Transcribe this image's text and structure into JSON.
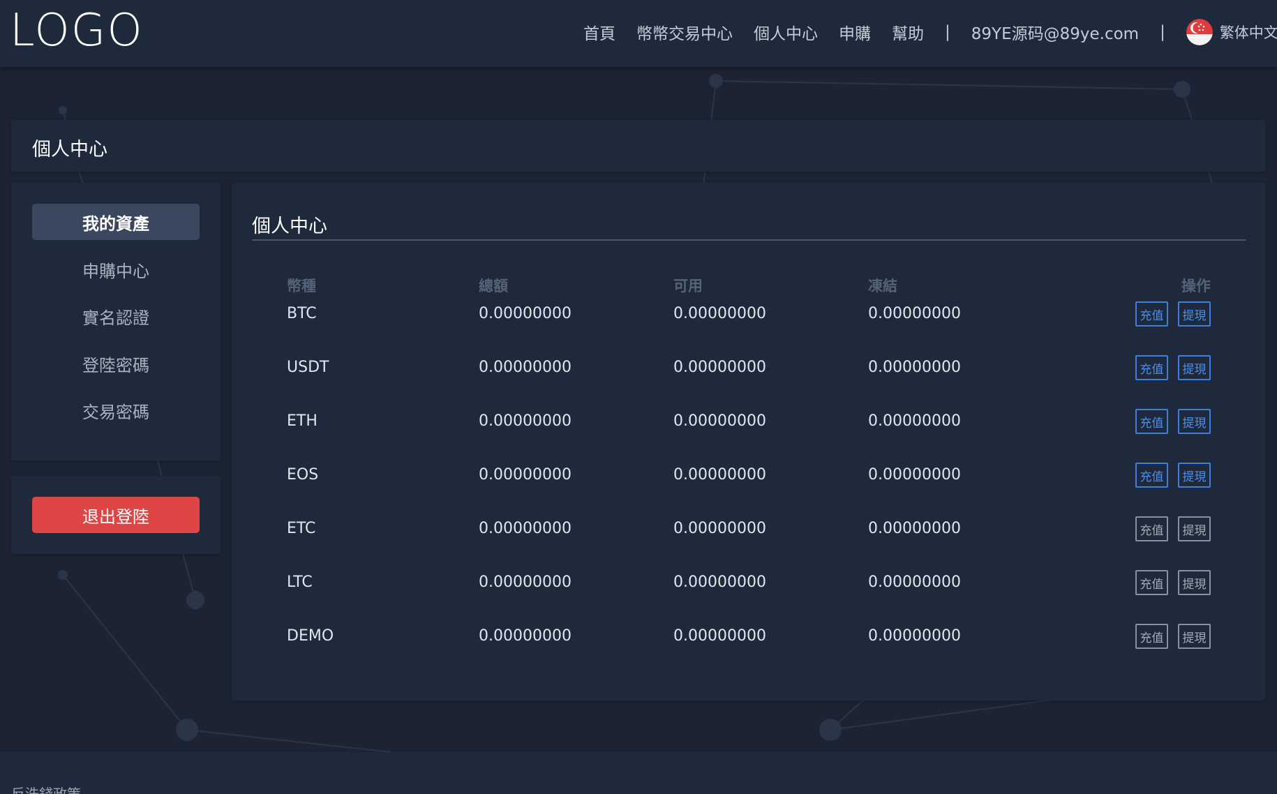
{
  "header": {
    "logo": "LOGO",
    "nav": [
      "首頁",
      "幣幣交易中心",
      "個人中心",
      "申購",
      "幫助"
    ],
    "separator": "|",
    "email": "89YE源码@89ye.com",
    "language": "繁体中文",
    "flag_icon": "singapore-flag-icon"
  },
  "page_title": "個人中心",
  "sidebar": {
    "items": [
      {
        "label": "我的資產",
        "active": true
      },
      {
        "label": "申購中心",
        "active": false
      },
      {
        "label": "實名認證",
        "active": false
      },
      {
        "label": "登陸密碼",
        "active": false
      },
      {
        "label": "交易密碼",
        "active": false
      }
    ],
    "logout": "退出登陸"
  },
  "panel": {
    "title": "個人中心",
    "columns": [
      "幣種",
      "總額",
      "可用",
      "凍結",
      "操作"
    ],
    "rows": [
      {
        "coin": "BTC",
        "total": "0.00000000",
        "available": "0.00000000",
        "frozen": "0.00000000",
        "deposit": "充值",
        "withdraw": "提現",
        "enabled": true
      },
      {
        "coin": "USDT",
        "total": "0.00000000",
        "available": "0.00000000",
        "frozen": "0.00000000",
        "deposit": "充值",
        "withdraw": "提現",
        "enabled": true
      },
      {
        "coin": "ETH",
        "total": "0.00000000",
        "available": "0.00000000",
        "frozen": "0.00000000",
        "deposit": "充值",
        "withdraw": "提現",
        "enabled": true
      },
      {
        "coin": "EOS",
        "total": "0.00000000",
        "available": "0.00000000",
        "frozen": "0.00000000",
        "deposit": "充值",
        "withdraw": "提現",
        "enabled": true
      },
      {
        "coin": "ETC",
        "total": "0.00000000",
        "available": "0.00000000",
        "frozen": "0.00000000",
        "deposit": "充值",
        "withdraw": "提現",
        "enabled": false
      },
      {
        "coin": "LTC",
        "total": "0.00000000",
        "available": "0.00000000",
        "frozen": "0.00000000",
        "deposit": "充值",
        "withdraw": "提現",
        "enabled": false
      },
      {
        "coin": "DEMO",
        "total": "0.00000000",
        "available": "0.00000000",
        "frozen": "0.00000000",
        "deposit": "充值",
        "withdraw": "提現",
        "enabled": false
      }
    ]
  },
  "footer": {
    "text": "反洗錢政策"
  },
  "colors": {
    "background": "#1c2433",
    "panel": "#1e2a3b",
    "active_menu": "#3b475e",
    "logout": "#e04546",
    "accent_blue": "#4a8ef0",
    "disabled_gray": "#a4abb4"
  }
}
